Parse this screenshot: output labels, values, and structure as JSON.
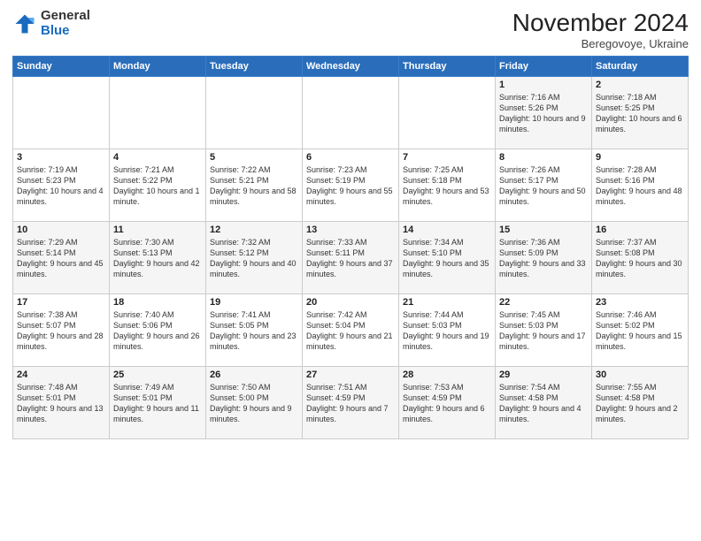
{
  "logo": {
    "general": "General",
    "blue": "Blue"
  },
  "title": "November 2024",
  "subtitle": "Beregovoye, Ukraine",
  "weekdays": [
    "Sunday",
    "Monday",
    "Tuesday",
    "Wednesday",
    "Thursday",
    "Friday",
    "Saturday"
  ],
  "weeks": [
    [
      {
        "day": "",
        "detail": ""
      },
      {
        "day": "",
        "detail": ""
      },
      {
        "day": "",
        "detail": ""
      },
      {
        "day": "",
        "detail": ""
      },
      {
        "day": "",
        "detail": ""
      },
      {
        "day": "1",
        "detail": "Sunrise: 7:16 AM\nSunset: 5:26 PM\nDaylight: 10 hours and 9 minutes."
      },
      {
        "day": "2",
        "detail": "Sunrise: 7:18 AM\nSunset: 5:25 PM\nDaylight: 10 hours and 6 minutes."
      }
    ],
    [
      {
        "day": "3",
        "detail": "Sunrise: 7:19 AM\nSunset: 5:23 PM\nDaylight: 10 hours and 4 minutes."
      },
      {
        "day": "4",
        "detail": "Sunrise: 7:21 AM\nSunset: 5:22 PM\nDaylight: 10 hours and 1 minute."
      },
      {
        "day": "5",
        "detail": "Sunrise: 7:22 AM\nSunset: 5:21 PM\nDaylight: 9 hours and 58 minutes."
      },
      {
        "day": "6",
        "detail": "Sunrise: 7:23 AM\nSunset: 5:19 PM\nDaylight: 9 hours and 55 minutes."
      },
      {
        "day": "7",
        "detail": "Sunrise: 7:25 AM\nSunset: 5:18 PM\nDaylight: 9 hours and 53 minutes."
      },
      {
        "day": "8",
        "detail": "Sunrise: 7:26 AM\nSunset: 5:17 PM\nDaylight: 9 hours and 50 minutes."
      },
      {
        "day": "9",
        "detail": "Sunrise: 7:28 AM\nSunset: 5:16 PM\nDaylight: 9 hours and 48 minutes."
      }
    ],
    [
      {
        "day": "10",
        "detail": "Sunrise: 7:29 AM\nSunset: 5:14 PM\nDaylight: 9 hours and 45 minutes."
      },
      {
        "day": "11",
        "detail": "Sunrise: 7:30 AM\nSunset: 5:13 PM\nDaylight: 9 hours and 42 minutes."
      },
      {
        "day": "12",
        "detail": "Sunrise: 7:32 AM\nSunset: 5:12 PM\nDaylight: 9 hours and 40 minutes."
      },
      {
        "day": "13",
        "detail": "Sunrise: 7:33 AM\nSunset: 5:11 PM\nDaylight: 9 hours and 37 minutes."
      },
      {
        "day": "14",
        "detail": "Sunrise: 7:34 AM\nSunset: 5:10 PM\nDaylight: 9 hours and 35 minutes."
      },
      {
        "day": "15",
        "detail": "Sunrise: 7:36 AM\nSunset: 5:09 PM\nDaylight: 9 hours and 33 minutes."
      },
      {
        "day": "16",
        "detail": "Sunrise: 7:37 AM\nSunset: 5:08 PM\nDaylight: 9 hours and 30 minutes."
      }
    ],
    [
      {
        "day": "17",
        "detail": "Sunrise: 7:38 AM\nSunset: 5:07 PM\nDaylight: 9 hours and 28 minutes."
      },
      {
        "day": "18",
        "detail": "Sunrise: 7:40 AM\nSunset: 5:06 PM\nDaylight: 9 hours and 26 minutes."
      },
      {
        "day": "19",
        "detail": "Sunrise: 7:41 AM\nSunset: 5:05 PM\nDaylight: 9 hours and 23 minutes."
      },
      {
        "day": "20",
        "detail": "Sunrise: 7:42 AM\nSunset: 5:04 PM\nDaylight: 9 hours and 21 minutes."
      },
      {
        "day": "21",
        "detail": "Sunrise: 7:44 AM\nSunset: 5:03 PM\nDaylight: 9 hours and 19 minutes."
      },
      {
        "day": "22",
        "detail": "Sunrise: 7:45 AM\nSunset: 5:03 PM\nDaylight: 9 hours and 17 minutes."
      },
      {
        "day": "23",
        "detail": "Sunrise: 7:46 AM\nSunset: 5:02 PM\nDaylight: 9 hours and 15 minutes."
      }
    ],
    [
      {
        "day": "24",
        "detail": "Sunrise: 7:48 AM\nSunset: 5:01 PM\nDaylight: 9 hours and 13 minutes."
      },
      {
        "day": "25",
        "detail": "Sunrise: 7:49 AM\nSunset: 5:01 PM\nDaylight: 9 hours and 11 minutes."
      },
      {
        "day": "26",
        "detail": "Sunrise: 7:50 AM\nSunset: 5:00 PM\nDaylight: 9 hours and 9 minutes."
      },
      {
        "day": "27",
        "detail": "Sunrise: 7:51 AM\nSunset: 4:59 PM\nDaylight: 9 hours and 7 minutes."
      },
      {
        "day": "28",
        "detail": "Sunrise: 7:53 AM\nSunset: 4:59 PM\nDaylight: 9 hours and 6 minutes."
      },
      {
        "day": "29",
        "detail": "Sunrise: 7:54 AM\nSunset: 4:58 PM\nDaylight: 9 hours and 4 minutes."
      },
      {
        "day": "30",
        "detail": "Sunrise: 7:55 AM\nSunset: 4:58 PM\nDaylight: 9 hours and 2 minutes."
      }
    ]
  ]
}
